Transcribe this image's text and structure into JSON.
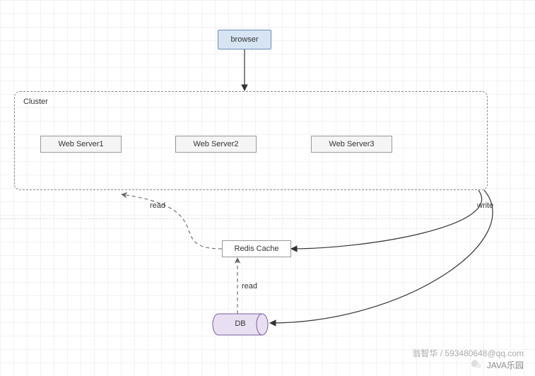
{
  "nodes": {
    "browser": "browser",
    "cluster": "Cluster",
    "ws1": "Web Server1",
    "ws2": "Web Server2",
    "ws3": "Web Server3",
    "redis": "Redis Cache",
    "db": "DB"
  },
  "edges": {
    "read1": "read",
    "read2": "read",
    "write": "write"
  },
  "watermark": {
    "author": "翁智华 / 593480648@qq.com",
    "brand": "JAVA乐园"
  },
  "chart_data": {
    "type": "diagram",
    "title": "",
    "nodes": [
      {
        "id": "browser",
        "label": "browser",
        "shape": "rect"
      },
      {
        "id": "cluster",
        "label": "Cluster",
        "shape": "container",
        "children": [
          "ws1",
          "ws2",
          "ws3"
        ]
      },
      {
        "id": "ws1",
        "label": "Web Server1",
        "shape": "rect"
      },
      {
        "id": "ws2",
        "label": "Web Server2",
        "shape": "rect"
      },
      {
        "id": "ws3",
        "label": "Web Server3",
        "shape": "rect"
      },
      {
        "id": "redis",
        "label": "Redis Cache",
        "shape": "rect"
      },
      {
        "id": "db",
        "label": "DB",
        "shape": "cylinder"
      }
    ],
    "edges": [
      {
        "from": "browser",
        "to": "cluster",
        "style": "solid"
      },
      {
        "from": "redis",
        "to": "cluster",
        "label": "read",
        "style": "dashed"
      },
      {
        "from": "db",
        "to": "redis",
        "label": "read",
        "style": "dashed"
      },
      {
        "from": "cluster",
        "to": "redis",
        "label": "write",
        "style": "solid"
      },
      {
        "from": "cluster",
        "to": "db",
        "label": "write",
        "style": "solid"
      }
    ]
  }
}
